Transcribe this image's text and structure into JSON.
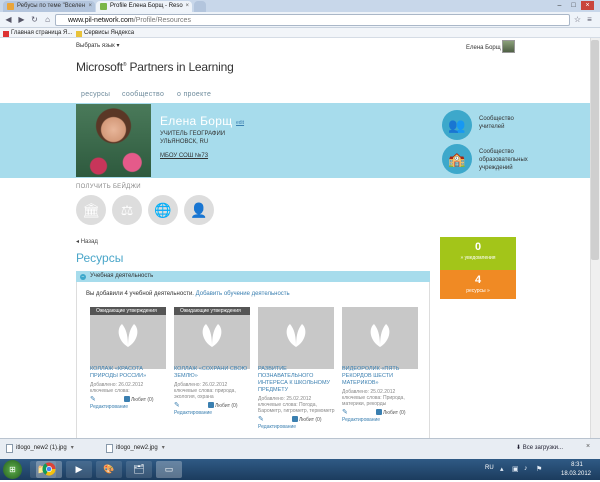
{
  "browser": {
    "tabs": [
      {
        "label": "Ребусы по теме \"Вселен",
        "active": false
      },
      {
        "label": "Profile Елена Борщ - Reso",
        "active": true
      }
    ],
    "url_host": "www.pil-network.com",
    "url_path": "/Profile/Resources",
    "bookmarks": [
      "Главная страница Я...",
      "Сервисы Яндекса"
    ]
  },
  "page": {
    "lang_select": "Выбрать язык",
    "user_name": "Елена Борщ",
    "logo": {
      "main": "Microsoft",
      "sup": "®",
      "rest": "Partners in Learning"
    },
    "nav": [
      "ресурсы",
      "сообщество",
      "о проекте"
    ],
    "profile": {
      "name": "Елена Борщ",
      "edit": "edit",
      "role": "УЧИТЕЛЬ ГЕОГРАФИИ",
      "city": "УЛЬЯНОВСК, RU",
      "school": "МБОУ СОШ №73"
    },
    "communities": [
      {
        "label_1": "Сообщество",
        "label_2": "учителей",
        "label_3": ""
      },
      {
        "label_1": "Сообщество",
        "label_2": "образовательных",
        "label_3": "учреждений"
      }
    ],
    "badges_title": "ПОЛУЧИТЬ БЕЙДЖИ",
    "back": "Назад",
    "resources_title": "Ресурсы",
    "activity_header": "Учебная деятельность",
    "added_text": "Вы добавили 4 учебной деятельности.",
    "add_link": "Добавить обучение деятельность",
    "cards": [
      {
        "pending": "Ожидающие утверждения",
        "title_1": "КОЛЛАЖ «КРАСОТА",
        "title_2": "ПРИРОДЫ РОССИИ»",
        "title_3": "",
        "title_4": "",
        "meta_1": "Добавлено: 26.02.2012",
        "meta_2": "ключевые слова:",
        "meta_3": "",
        "like": "Любит (0)",
        "edit": "Редактирование"
      },
      {
        "pending": "Ожидающие утверждения",
        "title_1": "КОЛЛАЖ «СОХРАНИ СВОЮ",
        "title_2": "ЗЕМЛЮ»",
        "title_3": "",
        "title_4": "",
        "meta_1": "Добавлено: 26.02.2012",
        "meta_2": "ключевые слова: природа,",
        "meta_3": "экология, охрана",
        "like": "Любит (0)",
        "edit": "Редактирование"
      },
      {
        "pending": "",
        "title_1": "РАЗВИТИЕ",
        "title_2": "ПОЗНАВАТЕЛЬНОГО",
        "title_3": "ИНТЕРЕСА К ШКОЛЬНОМУ",
        "title_4": "ПРЕДМЕТУ",
        "meta_1": "Добавлено: 25.02.2012",
        "meta_2": "ключевые слова: Погода,",
        "meta_3": "Барометр, гигрометр, термометр",
        "like": "Любит (0)",
        "edit": "Редактирование"
      },
      {
        "pending": "",
        "title_1": "ВИДЕОРОЛИК «ПЯТЬ",
        "title_2": "РЕКОРДОВ ШЕСТИ",
        "title_3": "МАТЕРИКОВ»",
        "title_4": "",
        "meta_1": "Добавлено: 25.02.2012",
        "meta_2": "ключевые слова: Природа,",
        "meta_3": "материки, рекорды",
        "like": "Любит (0)",
        "edit": "Редактирование"
      }
    ],
    "stats": [
      {
        "num": "0",
        "label": "» уведомления",
        "color": "#a3c519"
      },
      {
        "num": "4",
        "label": "ресурсы »",
        "color": "#f08a24"
      }
    ]
  },
  "downloads": {
    "items": [
      "itlogo_new2 (1).jpg",
      "itlogo_new2.jpg"
    ],
    "all_link": "Все загрузки...",
    "close": "×"
  },
  "taskbar": {
    "lang": "RU",
    "time": "8:31",
    "date": "18.03.2012"
  }
}
